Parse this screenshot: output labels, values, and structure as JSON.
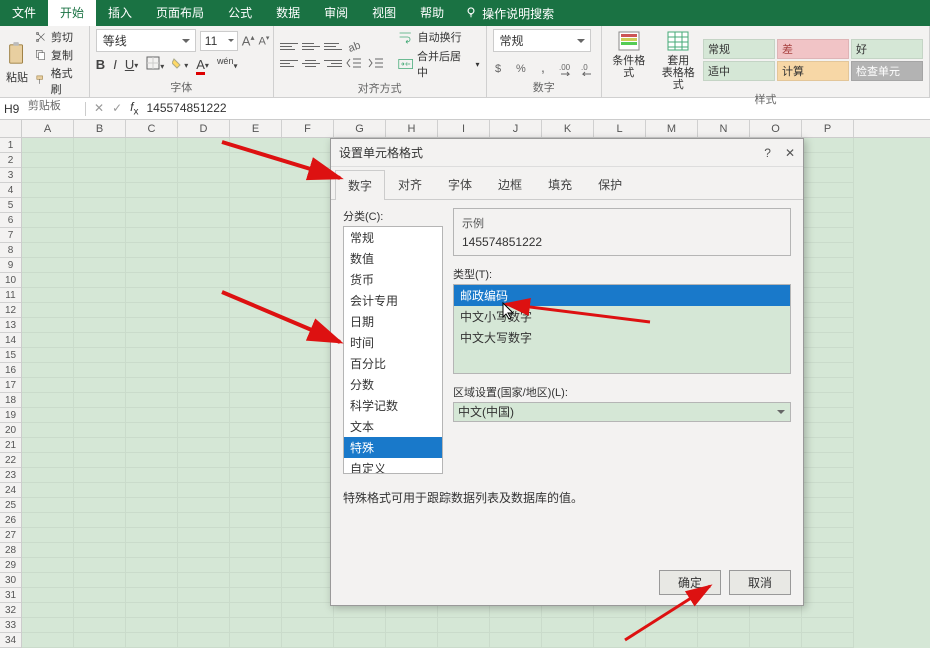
{
  "ribbon_tabs": {
    "file": "文件",
    "home": "开始",
    "insert": "插入",
    "pagelayout": "页面布局",
    "formulas": "公式",
    "data": "数据",
    "review": "审阅",
    "view": "视图",
    "help": "帮助",
    "tellme": "操作说明搜索"
  },
  "clipboard": {
    "paste": "粘贴",
    "cut": "剪切",
    "copy": "复制",
    "painter": "格式刷",
    "label": "剪贴板"
  },
  "font": {
    "name": "等线",
    "size": "11",
    "label": "字体"
  },
  "alignment": {
    "wrap": "自动换行",
    "merge": "合并后居中",
    "label": "对齐方式"
  },
  "number": {
    "format": "常规",
    "label": "数字"
  },
  "styles": {
    "cond": "条件格式",
    "table": "套用\n表格格式",
    "normal": "常规",
    "bad": "差",
    "good": "好",
    "neutral": "适中",
    "calc": "计算",
    "check": "检查单元",
    "label": "样式"
  },
  "namebox": "H9",
  "formula_value": "145574851222",
  "columns": [
    "A",
    "B",
    "C",
    "D",
    "E",
    "F",
    "G",
    "H",
    "I",
    "J",
    "K",
    "L",
    "M",
    "N",
    "O",
    "P"
  ],
  "dialog": {
    "title": "设置单元格格式",
    "tabs": {
      "number": "数字",
      "alignment": "对齐",
      "font": "字体",
      "border": "边框",
      "fill": "填充",
      "protection": "保护"
    },
    "category_label": "分类(C):",
    "categories": [
      "常规",
      "数值",
      "货币",
      "会计专用",
      "日期",
      "时间",
      "百分比",
      "分数",
      "科学记数",
      "文本",
      "特殊",
      "自定义"
    ],
    "selected_category": "特殊",
    "sample_label": "示例",
    "sample_value": "145574851222",
    "type_label": "类型(T):",
    "types": [
      "邮政编码",
      "中文小写数字",
      "中文大写数字"
    ],
    "selected_type": "邮政编码",
    "locale_label": "区域设置(国家/地区)(L):",
    "locale_value": "中文(中国)",
    "description": "特殊格式可用于跟踪数据列表及数据库的值。",
    "ok": "确定",
    "cancel": "取消"
  }
}
